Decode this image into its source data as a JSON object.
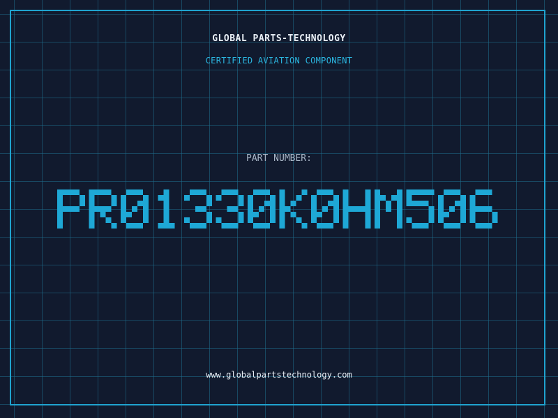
{
  "company": "GLOBAL PARTS-TECHNOLOGY",
  "subtitle": "CERTIFIED AVIATION COMPONENT",
  "part_label": "PART NUMBER:",
  "part_number": "PR01330K0HM506",
  "website": "www.globalpartstechnology.com",
  "colors": {
    "background": "#111a2e",
    "grid": "#1e6e8c",
    "accent": "#1fa3cf",
    "text": "#e8eef5",
    "part_number": "#1ea8d6"
  }
}
